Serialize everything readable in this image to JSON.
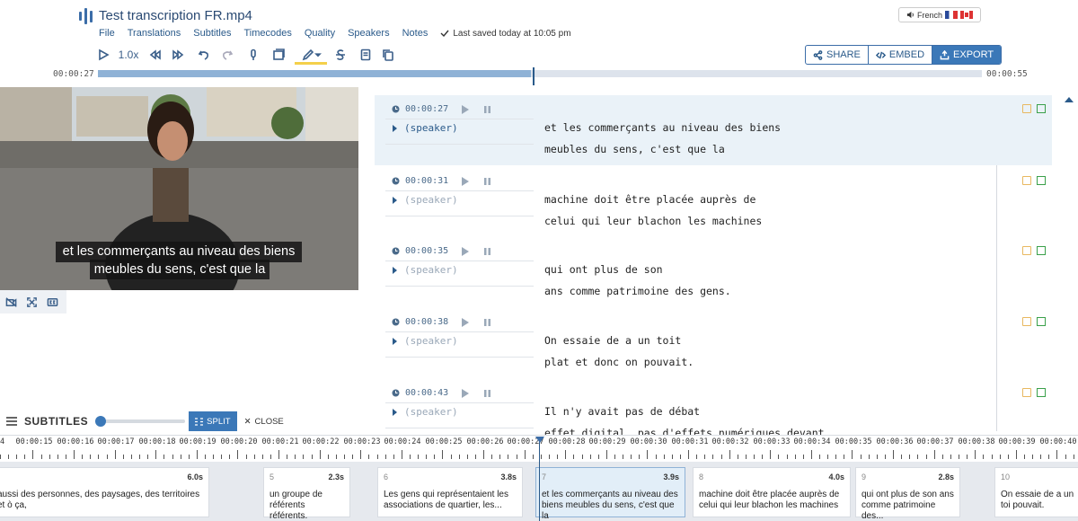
{
  "header": {
    "title": "Test transcription FR.mp4",
    "menu": [
      "File",
      "Translations",
      "Subtitles",
      "Timecodes",
      "Quality",
      "Speakers",
      "Notes"
    ],
    "saved_status": "Last saved today at 10:05 pm",
    "language": "French"
  },
  "toolbar": {
    "speed": "1.0x",
    "share_label": "SHARE",
    "embed_label": "EMBED",
    "export_label": "EXPORT"
  },
  "progress": {
    "current_time": "00:00:27",
    "end_time": "00:00:55",
    "fraction": 0.49
  },
  "video": {
    "caption_line1": "et les commerçants au niveau des biens",
    "caption_line2": "meubles du sens, c'est que la"
  },
  "segments": [
    {
      "time": "00:00:27",
      "speaker": "(speaker)",
      "line1": "et les commerçants au niveau des biens",
      "line2": "meubles du sens, c'est que la"
    },
    {
      "time": "00:00:31",
      "speaker": "(speaker)",
      "line1": "machine doit être placée auprès de",
      "line2": "celui qui leur blachon les machines"
    },
    {
      "time": "00:00:35",
      "speaker": "(speaker)",
      "line1": "qui ont plus de son",
      "line2": "ans comme patrimoine des gens."
    },
    {
      "time": "00:00:38",
      "speaker": "(speaker)",
      "line1": "On essaie de a un toit",
      "line2": "plat et donc on pouvait."
    },
    {
      "time": "00:00:43",
      "speaker": "(speaker)",
      "line1": "Il n'y avait pas de débat",
      "line2": "effet digital, pas d'effets numériques devant"
    }
  ],
  "subtitles_bar": {
    "label": "SUBTITLES",
    "split_label": "SPLIT",
    "close_label": "CLOSE"
  },
  "timeline": {
    "ticks": [
      "00:00:15",
      "00:00:16",
      "00:00:17",
      "00:00:18",
      "00:00:19",
      "00:00:20",
      "00:00:21",
      "00:00:22",
      "00:00:23",
      "00:00:24",
      "00:00:25",
      "00:00:26",
      "00:00:27",
      "00:00:28",
      "00:00:29",
      "00:00:30",
      "00:00:31",
      "00:00:32",
      "00:00:33",
      "00:00:34",
      "00:00:35",
      "00:00:36",
      "00:00:37",
      "00:00:38",
      "00:00:39",
      "00:00:40"
    ],
    "cards": [
      {
        "num": "",
        "dur": "6.0s",
        "text": "aussi des personnes, des paysages, des territoires et ò ça,"
      },
      {
        "num": "5",
        "dur": "2.3s",
        "text": "un groupe de référents référents."
      },
      {
        "num": "6",
        "dur": "3.8s",
        "text": "Les gens qui représentaient les associations de quartier, les..."
      },
      {
        "num": "7",
        "dur": "3.9s",
        "text": "et les commerçants au niveau des biens meubles du sens, c'est que la"
      },
      {
        "num": "8",
        "dur": "4.0s",
        "text": "machine doit être placée auprès de celui qui leur blachon les machines"
      },
      {
        "num": "9",
        "dur": "2.8s",
        "text": "qui ont plus de son ans comme patrimoine des..."
      },
      {
        "num": "10",
        "dur": "",
        "text": "On essaie de a un toi pouvait."
      }
    ]
  }
}
